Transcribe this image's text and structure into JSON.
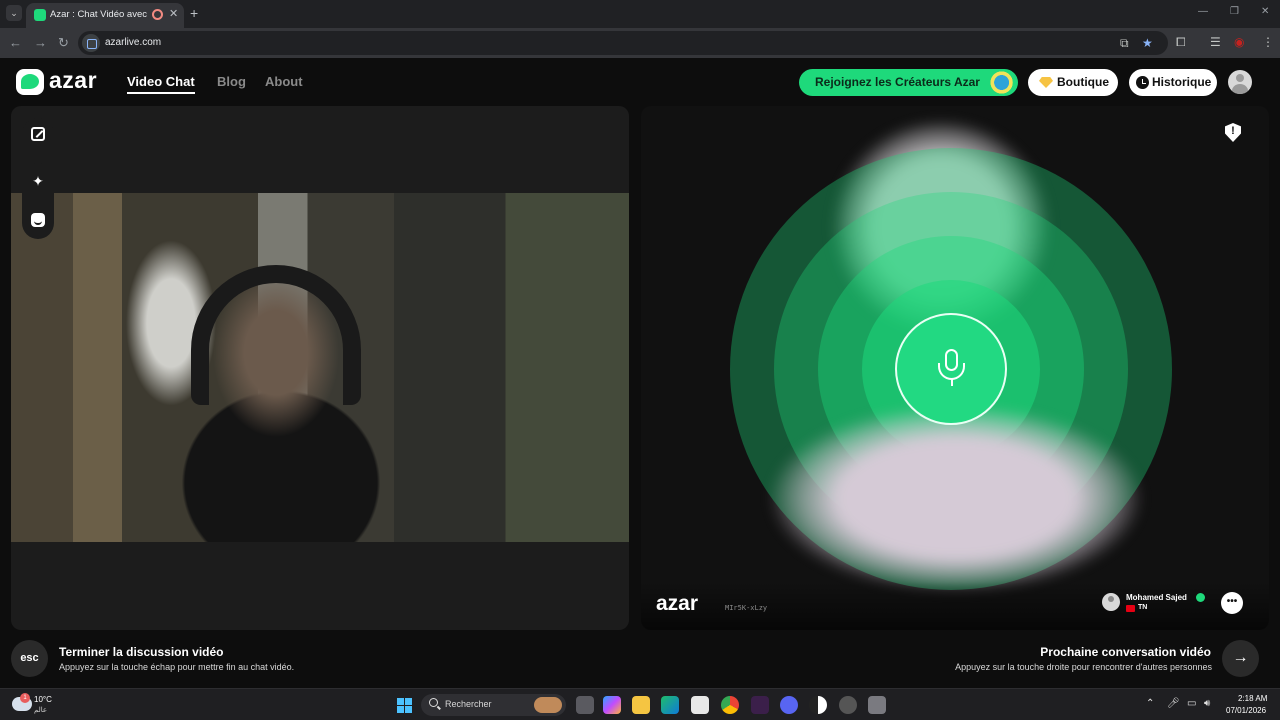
{
  "browser": {
    "tab_title": "Azar : Chat Vidéo avec de n",
    "url": "azarlive.com"
  },
  "site": {
    "logo_text": "azar",
    "nav": [
      "Video Chat",
      "Blog",
      "About"
    ],
    "creators_button": "Rejoignez les Créateurs Azar",
    "boutique_button": "Boutique",
    "historique_button": "Historique"
  },
  "remote": {
    "logo_text": "azar",
    "match_id": "MIr5K-xLzy",
    "user_name": "Mohamed Sajed",
    "country": "TN"
  },
  "hints": {
    "esc_key": "esc",
    "end_title": "Terminer la discussion vidéo",
    "end_sub": "Appuyez sur la touche échap pour mettre fin au chat vidéo.",
    "next_title": "Prochaine conversation vidéo",
    "next_sub": "Appuyez sur la touche droite pour rencontrer d'autres personnes"
  },
  "taskbar": {
    "temperature": "10°C",
    "weather_sub": "عالم",
    "weather_badge": "1",
    "search_placeholder": "Rechercher",
    "time": "2:18 AM",
    "date": "07/01/2026"
  },
  "colors": {
    "accent": "#1ed97b",
    "page_bg": "#0d0d0d"
  }
}
